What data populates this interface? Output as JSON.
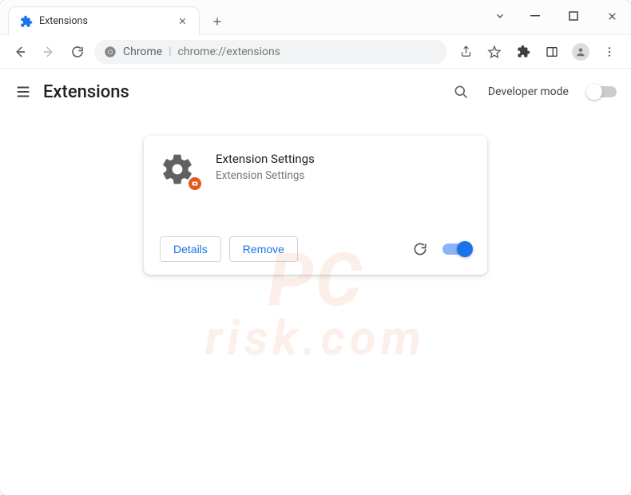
{
  "window": {
    "tab_title": "Extensions",
    "chrome_label": "Chrome",
    "url_display": "chrome://extensions"
  },
  "header": {
    "page_title": "Extensions",
    "dev_mode_label": "Developer mode",
    "dev_mode_on": false
  },
  "extension": {
    "name": "Extension Settings",
    "description": "Extension Settings",
    "details_label": "Details",
    "remove_label": "Remove",
    "enabled": true
  },
  "watermark": {
    "line1": "PC",
    "line2": "risk.com"
  },
  "colors": {
    "accent": "#1a73e8",
    "badge": "#e25a1b"
  }
}
